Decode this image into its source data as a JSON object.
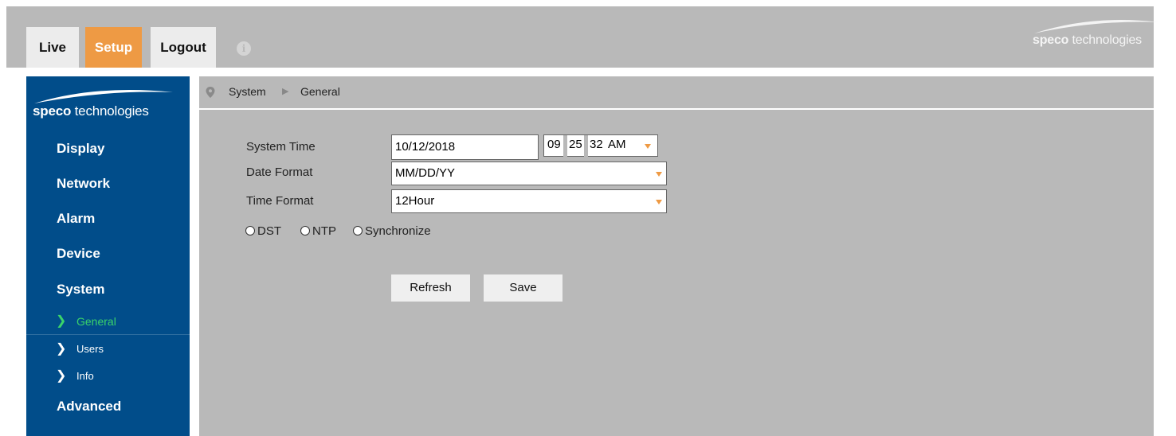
{
  "header": {
    "tabs": [
      {
        "label": "Live"
      },
      {
        "label": "Setup"
      },
      {
        "label": "Logout"
      }
    ],
    "logo": {
      "brand_bold": "speco",
      "brand_rest": " technologies"
    }
  },
  "sidebar": {
    "logo": {
      "brand_bold": "speco",
      "brand_rest": " technologies"
    },
    "items": [
      {
        "label": "Display"
      },
      {
        "label": "Network"
      },
      {
        "label": "Alarm"
      },
      {
        "label": "Device"
      },
      {
        "label": "System"
      },
      {
        "label": "Advanced"
      }
    ],
    "sub_items": [
      {
        "label": "General"
      },
      {
        "label": "Users"
      },
      {
        "label": "Info"
      }
    ]
  },
  "breadcrumb": {
    "level1": "System",
    "level2": "General"
  },
  "form": {
    "system_time_label": "System Time",
    "date_value": "10/12/2018",
    "time": {
      "hour": "09",
      "minute": "25",
      "second": "32",
      "ampm": "AM"
    },
    "date_format_label": "Date Format",
    "date_format_value": "MM/DD/YY",
    "time_format_label": "Time Format",
    "time_format_value": "12Hour",
    "options": [
      {
        "label": "DST"
      },
      {
        "label": "NTP"
      },
      {
        "label": "Synchronize"
      }
    ]
  },
  "buttons": {
    "refresh": "Refresh",
    "save": "Save"
  },
  "colors": {
    "accent": "#ee9a44",
    "sidebar": "#014d8a",
    "active_sub": "#3ad46a",
    "panel": "#b9b9b9"
  }
}
